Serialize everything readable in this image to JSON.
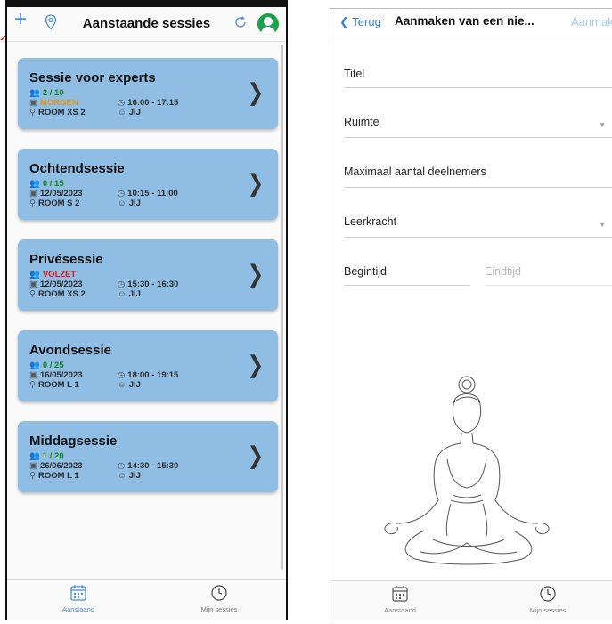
{
  "left_screen": {
    "header": {
      "title": "Aanstaande sessies",
      "plus_icon": "+"
    },
    "sessions": [
      {
        "title": "Sessie voor experts",
        "count": "2 / 10",
        "count_color": "green",
        "date": "MORGEN",
        "date_color": "orange",
        "time": "16:00 - 17:15",
        "room": "ROOM XS 2",
        "teacher": "JIJ"
      },
      {
        "title": "Ochtendsessie",
        "count": "0 / 15",
        "count_color": "green",
        "date": "12/05/2023",
        "date_color": "normal",
        "time": "10:15 - 11:00",
        "room": "ROOM S 2",
        "teacher": "JIJ"
      },
      {
        "title": "Privésessie",
        "count": "VOLZET",
        "count_color": "red",
        "date": "12/05/2023",
        "date_color": "normal",
        "time": "15:30 - 16:30",
        "room": "ROOM XS 2",
        "teacher": "JIJ"
      },
      {
        "title": "Avondsessie",
        "count": "0 / 25",
        "count_color": "green",
        "date": "16/05/2023",
        "date_color": "normal",
        "time": "18:00 - 19:15",
        "room": "ROOM L 1",
        "teacher": "JIJ"
      },
      {
        "title": "Middagsessie",
        "count": "1 / 20",
        "count_color": "green",
        "date": "26/06/2023",
        "date_color": "normal",
        "time": "14:30 - 15:30",
        "room": "ROOM L 1",
        "teacher": "JIJ"
      }
    ],
    "tabbar": {
      "tab1": "Aanstaand",
      "tab2": "Mijn sessies"
    }
  },
  "right_screen": {
    "header": {
      "back": "Terug",
      "title": "Aanmaken van een nie...",
      "create": "Aanmaken"
    },
    "fields": {
      "titel": "Titel",
      "ruimte": "Ruimte",
      "max": "Maximaal aantal deelnemers",
      "leerkracht": "Leerkracht",
      "begintijd": "Begintijd",
      "eindtijd": "Eindtijd"
    },
    "tabbar": {
      "tab1": "Aanstaand",
      "tab2": "Mijn sessies"
    }
  },
  "colors": {
    "accent": "#4a8fe0",
    "card": "#8fbde3",
    "green": "#0f8a1a",
    "orange": "#e39b16",
    "red": "#e01616",
    "avatar": "#1aa14a"
  },
  "icons": [
    "plus-icon",
    "location-pin-icon",
    "refresh-icon",
    "avatar-icon",
    "chevron-right-icon",
    "people-icon",
    "calendar-icon",
    "clock-icon",
    "person-icon",
    "location-pin-icon",
    "dropdown-caret-icon",
    "back-chevron-icon"
  ]
}
